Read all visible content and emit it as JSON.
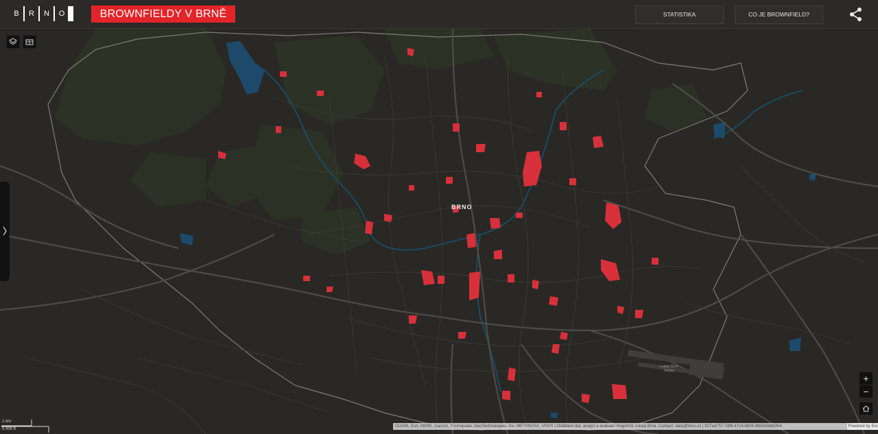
{
  "header": {
    "logo_letters": [
      "B",
      "R",
      "N",
      "O"
    ],
    "title": "BROWNFIELDY V BRNĚ",
    "nav": [
      "STATISTIKA",
      "CO JE BROWNFIELD?"
    ],
    "share_icon": "share-icon"
  },
  "map": {
    "city_label": "BRNO",
    "airport_label_1": "Letiště Brno",
    "airport_label_2": "Tuřany",
    "brownfield_color": "#d8303a",
    "tools": [
      "layers-icon",
      "basemap-icon"
    ],
    "side_tab_icon": "chevron-right-icon"
  },
  "controls": {
    "zoom_in": "+",
    "zoom_out": "−",
    "home_icon": "home-icon"
  },
  "scale": {
    "metric": "1 km",
    "imperial": "5 000 ft"
  },
  "attribution": {
    "text": "GUGIK, Esri, HERE, Garmin, Foursquare, GeoTechnologies, Inc, METI/NASA, USGS | Oddělení dat, analýz a evaluací Magistrát města Brna. Contact: data@brno.cz | 927ed757-7df9-47c4-b605-fbb0c6b68354",
    "powered": "Powered by Esri"
  }
}
